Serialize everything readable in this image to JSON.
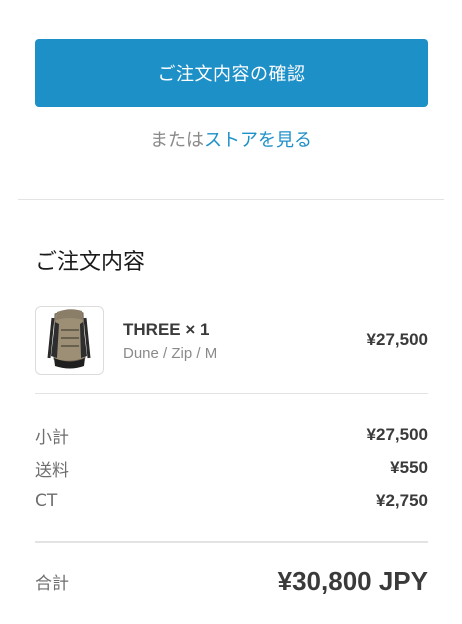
{
  "actions": {
    "confirm_label": "ご注文内容の確認",
    "alt_prefix": "または",
    "store_link_label": "ストアを見る"
  },
  "summary": {
    "title": "ご注文内容",
    "product": {
      "name": "THREE × 1",
      "variant": "Dune / Zip / M",
      "price": "¥27,500",
      "image_icon": "backpack-image"
    },
    "lines": [
      {
        "label": "小計",
        "value": "¥27,500"
      },
      {
        "label": "送料",
        "value": "¥550"
      },
      {
        "label": "CT",
        "value": "¥2,750"
      }
    ],
    "total": {
      "label": "合計",
      "value": "¥30,800 JPY"
    }
  },
  "colors": {
    "accent": "#1e90c8",
    "text": "#3a3a3a",
    "muted": "#8a8a8a",
    "divider": "#e3e3e3"
  }
}
